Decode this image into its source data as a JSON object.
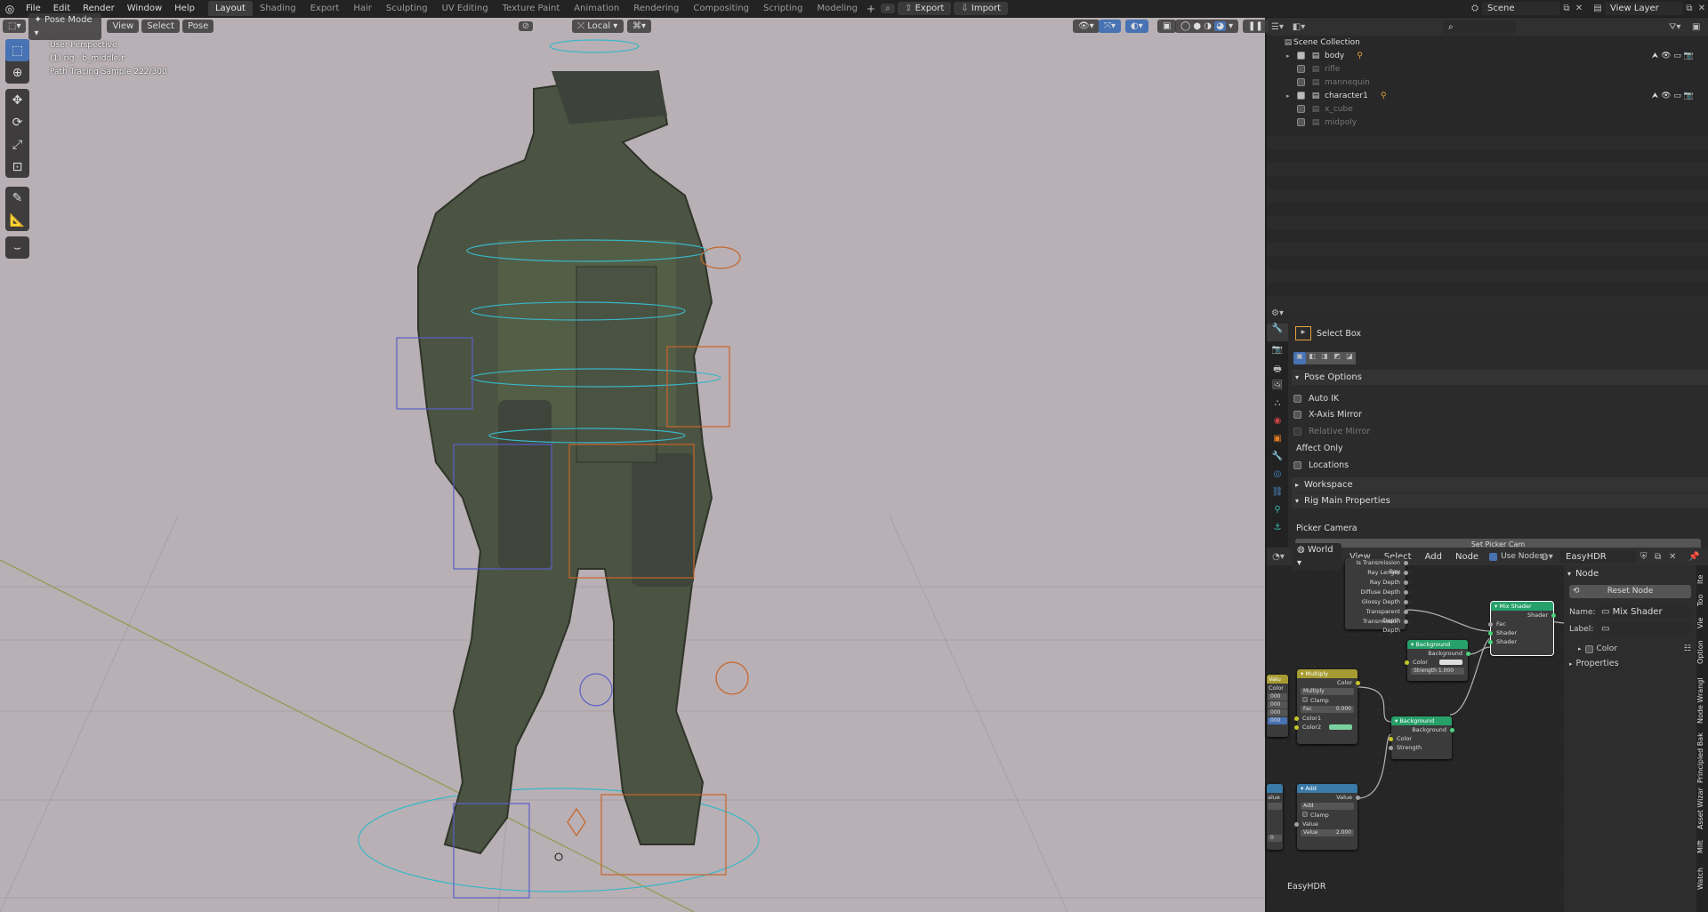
{
  "top_menu": {
    "items": [
      "File",
      "Edit",
      "Render",
      "Window",
      "Help"
    ],
    "workspaces": [
      "Layout",
      "Shading",
      "Export",
      "Hair",
      "Sculpting",
      "UV Editing",
      "Texture Paint",
      "Animation",
      "Rendering",
      "Compositing",
      "Scripting",
      "Modeling"
    ],
    "active_workspace": "Layout",
    "export_label": "Export",
    "import_label": "Import",
    "scene_name": "Scene",
    "view_layer_name": "View Layer"
  },
  "viewport": {
    "mode": "Pose Mode",
    "menus": [
      "View",
      "Select",
      "Pose"
    ],
    "transform_orientation": "Local",
    "overlay_lines": [
      "User Perspective",
      "(1) rig : b_middle.r",
      "Path Tracing Sample 222/300"
    ],
    "background_color": "#b8b0b4"
  },
  "outliner": {
    "root": "Scene Collection",
    "items": [
      {
        "name": "body",
        "checked": true,
        "expandable": true,
        "dim": false
      },
      {
        "name": "rifle",
        "checked": false,
        "expandable": false,
        "dim": true
      },
      {
        "name": "mannequin",
        "checked": false,
        "expandable": false,
        "dim": true
      },
      {
        "name": "character1",
        "checked": true,
        "expandable": true,
        "dim": false
      },
      {
        "name": "x_cube",
        "checked": false,
        "expandable": false,
        "dim": true
      },
      {
        "name": "midpoly",
        "checked": false,
        "expandable": false,
        "dim": true
      }
    ]
  },
  "properties": {
    "tool_name": "Select Box",
    "pose_options_title": "Pose Options",
    "auto_ik": "Auto IK",
    "x_axis_mirror": "X-Axis Mirror",
    "relative_mirror": "Relative Mirror",
    "affect_only": "Affect Only",
    "locations": "Locations",
    "workspace_title": "Workspace",
    "rig_main_title": "Rig Main Properties",
    "picker_camera": "Picker Camera",
    "set_picker_cam": "Set Picker Cam"
  },
  "node_editor": {
    "world_label": "World",
    "menus": [
      "View",
      "Select",
      "Add",
      "Node"
    ],
    "use_nodes": "Use Nodes",
    "world_name": "EasyHDR",
    "footer_label": "EasyHDR",
    "light_path_outputs": [
      "Is Transmission Ray",
      "Ray Length",
      "Ray Depth",
      "Diffuse Depth",
      "Glossy Depth",
      "Transparent Depth",
      "Transmission Depth"
    ],
    "mix_shader": {
      "title": "Mix Shader",
      "out": "Shader",
      "inputs": [
        "Fac",
        "Shader",
        "Shader"
      ]
    },
    "background1": {
      "title": "Background",
      "out": "Background",
      "color": "Color",
      "strength": "Strength",
      "strength_value": "1.000"
    },
    "multiply": {
      "title": "Multiply",
      "out": "Color",
      "op": "Multiply",
      "clamp": "Clamp",
      "fac": "Fac",
      "fac_value": "0.000",
      "color1": "Color1",
      "color2": "Color2"
    },
    "background2": {
      "title": "Background",
      "out": "Background",
      "color": "Color",
      "strength": "Strength"
    },
    "add": {
      "title": "Add",
      "out": "Value",
      "op": "Add",
      "clamp": "Clamp",
      "value": "Value",
      "value2": "Value",
      "value2_num": "2.000"
    },
    "partial_left": {
      "value_title": "Valu",
      "color": "Color",
      "nums": [
        "000",
        "000",
        "000",
        "000"
      ],
      "value": "alue",
      "num2": "0"
    }
  },
  "node_sidebar": {
    "title": "Node",
    "reset": "Reset Node",
    "name_label": "Name:",
    "name_value": "Mix Shader",
    "label_label": "Label:",
    "color_label": "Color",
    "properties_label": "Properties",
    "tabs": [
      "Ite",
      "Too",
      "Vie",
      "Option",
      "Node Wrangl",
      "Principled Bak",
      "Asset Wizar",
      "Mift",
      "Watch"
    ]
  },
  "colors": {
    "accent": "#4772b3",
    "shader_node": "#27a06a",
    "converter_node": "#3a7aa8",
    "color_node": "#a69b32"
  }
}
